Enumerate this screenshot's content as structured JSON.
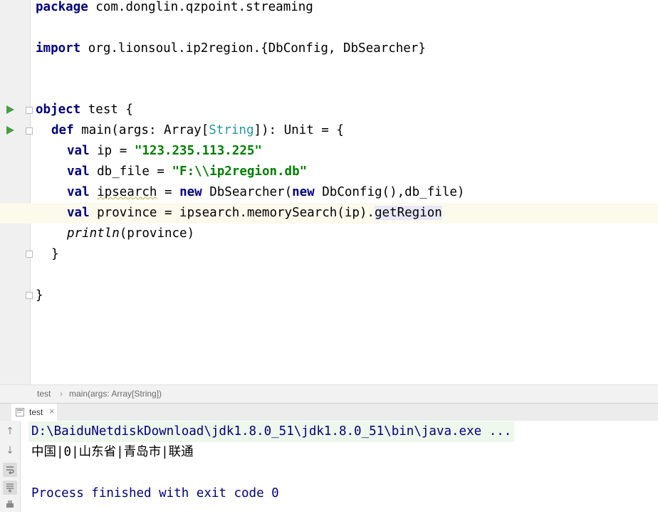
{
  "editor": {
    "lines": {
      "package_kw": "package",
      "package_name": " com.donglin.qzpoint.streaming",
      "import_kw": "import",
      "import_path": " org.lionsoul.ip2region.{DbConfig, DbSearcher}",
      "object_kw": "object",
      "object_rest": " test {",
      "def_kw": "def",
      "def_name": " main(args: Array[",
      "def_type": "String",
      "def_rest": "]): Unit = {",
      "ip_kw": "val",
      "ip_name": " ip = ",
      "ip_value": "\"123.235.113.225\"",
      "db_kw": "val",
      "db_name": " db_file = ",
      "db_value": "\"F:\\\\ip2region.db\"",
      "search_kw": "val",
      "search_var": "ipsearch",
      "search_eq": " = ",
      "search_new1": "new",
      "search_mid": " DbSearcher(",
      "search_new2": "new",
      "search_tail": " DbConfig(),db_file)",
      "prov_kw": "val",
      "prov_mid": " province = ipsearch.memorySearch(ip).",
      "prov_method": "getRegion",
      "println_fn": "println",
      "println_args": "(province)",
      "close_inner": "}",
      "close_outer": "}"
    }
  },
  "breadcrumb": {
    "item1": "test",
    "sep": "›",
    "item2": "main(args: Array[String])"
  },
  "run_panel": {
    "tab_label": "test",
    "tab_close": "×",
    "command_line": "D:\\BaiduNetdiskDownload\\jdk1.8.0_51\\jdk1.8.0_51\\bin\\java.exe ...",
    "output_line": "中国|0|山东省|青岛市|联通",
    "finish_line": "Process finished with exit code 0"
  },
  "colors": {
    "keyword": "#000080",
    "string": "#008000",
    "type": "#20999d",
    "run_green": "#4a9c45"
  }
}
